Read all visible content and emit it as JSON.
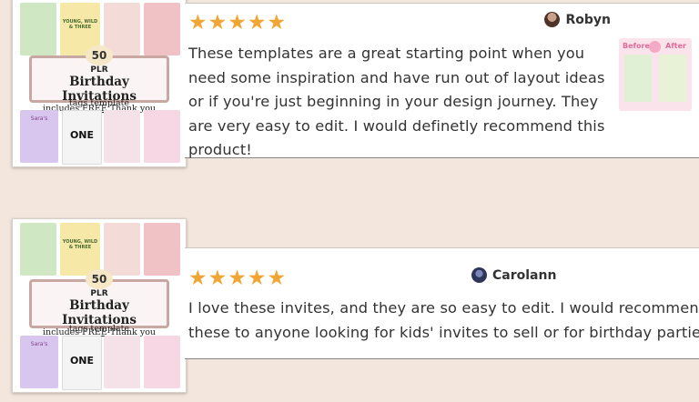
{
  "reviews": [
    {
      "rating": 5,
      "stars": "★★★★★",
      "reviewer": "Robyn",
      "lines": [
        "These templates are a great starting point when you",
        "need some inspiration and have run out of layout ideas",
        "or if you're just beginning in your design journey. They",
        "are very easy to edit. I would definetly recommend this",
        "product!"
      ],
      "photo": {
        "before_label": "Before",
        "after_label": "After"
      }
    },
    {
      "rating": 5,
      "stars": "★★★★★",
      "reviewer": "Carolann",
      "lines": [
        "I love these invites, and they are so easy to edit. I would recommend",
        "these to anyone looking for kids' invites to sell or for birthday parties."
      ]
    }
  ],
  "product": {
    "count": "50",
    "plr": "PLR",
    "title": "Birthday Invitations",
    "subtitle_prefix": "includes ",
    "subtitle_free": "FREE",
    "subtitle_suffix": " Thank you",
    "subtitle_line2": "tags template",
    "tiles": {
      "wild": "YOUNG, WILD & THREE",
      "one": "ONE",
      "name": "Sara's"
    }
  },
  "colors": {
    "background": "#f3e6dc",
    "star": "#f1a534",
    "text": "#333333"
  }
}
